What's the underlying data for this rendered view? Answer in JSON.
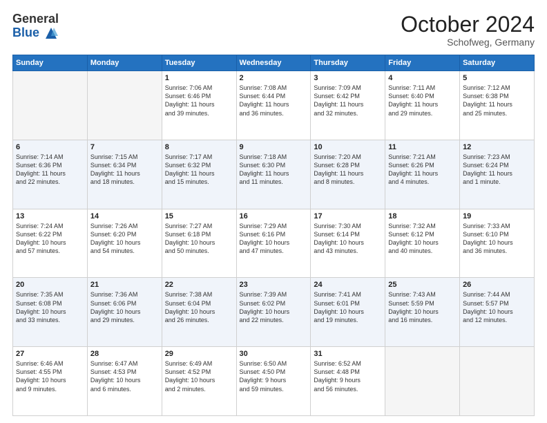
{
  "header": {
    "logo_general": "General",
    "logo_blue": "Blue",
    "month_title": "October 2024",
    "subtitle": "Schofweg, Germany"
  },
  "days_of_week": [
    "Sunday",
    "Monday",
    "Tuesday",
    "Wednesday",
    "Thursday",
    "Friday",
    "Saturday"
  ],
  "weeks": [
    [
      {
        "day": "",
        "info": ""
      },
      {
        "day": "",
        "info": ""
      },
      {
        "day": "1",
        "info": "Sunrise: 7:06 AM\nSunset: 6:46 PM\nDaylight: 11 hours\nand 39 minutes."
      },
      {
        "day": "2",
        "info": "Sunrise: 7:08 AM\nSunset: 6:44 PM\nDaylight: 11 hours\nand 36 minutes."
      },
      {
        "day": "3",
        "info": "Sunrise: 7:09 AM\nSunset: 6:42 PM\nDaylight: 11 hours\nand 32 minutes."
      },
      {
        "day": "4",
        "info": "Sunrise: 7:11 AM\nSunset: 6:40 PM\nDaylight: 11 hours\nand 29 minutes."
      },
      {
        "day": "5",
        "info": "Sunrise: 7:12 AM\nSunset: 6:38 PM\nDaylight: 11 hours\nand 25 minutes."
      }
    ],
    [
      {
        "day": "6",
        "info": "Sunrise: 7:14 AM\nSunset: 6:36 PM\nDaylight: 11 hours\nand 22 minutes."
      },
      {
        "day": "7",
        "info": "Sunrise: 7:15 AM\nSunset: 6:34 PM\nDaylight: 11 hours\nand 18 minutes."
      },
      {
        "day": "8",
        "info": "Sunrise: 7:17 AM\nSunset: 6:32 PM\nDaylight: 11 hours\nand 15 minutes."
      },
      {
        "day": "9",
        "info": "Sunrise: 7:18 AM\nSunset: 6:30 PM\nDaylight: 11 hours\nand 11 minutes."
      },
      {
        "day": "10",
        "info": "Sunrise: 7:20 AM\nSunset: 6:28 PM\nDaylight: 11 hours\nand 8 minutes."
      },
      {
        "day": "11",
        "info": "Sunrise: 7:21 AM\nSunset: 6:26 PM\nDaylight: 11 hours\nand 4 minutes."
      },
      {
        "day": "12",
        "info": "Sunrise: 7:23 AM\nSunset: 6:24 PM\nDaylight: 11 hours\nand 1 minute."
      }
    ],
    [
      {
        "day": "13",
        "info": "Sunrise: 7:24 AM\nSunset: 6:22 PM\nDaylight: 10 hours\nand 57 minutes."
      },
      {
        "day": "14",
        "info": "Sunrise: 7:26 AM\nSunset: 6:20 PM\nDaylight: 10 hours\nand 54 minutes."
      },
      {
        "day": "15",
        "info": "Sunrise: 7:27 AM\nSunset: 6:18 PM\nDaylight: 10 hours\nand 50 minutes."
      },
      {
        "day": "16",
        "info": "Sunrise: 7:29 AM\nSunset: 6:16 PM\nDaylight: 10 hours\nand 47 minutes."
      },
      {
        "day": "17",
        "info": "Sunrise: 7:30 AM\nSunset: 6:14 PM\nDaylight: 10 hours\nand 43 minutes."
      },
      {
        "day": "18",
        "info": "Sunrise: 7:32 AM\nSunset: 6:12 PM\nDaylight: 10 hours\nand 40 minutes."
      },
      {
        "day": "19",
        "info": "Sunrise: 7:33 AM\nSunset: 6:10 PM\nDaylight: 10 hours\nand 36 minutes."
      }
    ],
    [
      {
        "day": "20",
        "info": "Sunrise: 7:35 AM\nSunset: 6:08 PM\nDaylight: 10 hours\nand 33 minutes."
      },
      {
        "day": "21",
        "info": "Sunrise: 7:36 AM\nSunset: 6:06 PM\nDaylight: 10 hours\nand 29 minutes."
      },
      {
        "day": "22",
        "info": "Sunrise: 7:38 AM\nSunset: 6:04 PM\nDaylight: 10 hours\nand 26 minutes."
      },
      {
        "day": "23",
        "info": "Sunrise: 7:39 AM\nSunset: 6:02 PM\nDaylight: 10 hours\nand 22 minutes."
      },
      {
        "day": "24",
        "info": "Sunrise: 7:41 AM\nSunset: 6:01 PM\nDaylight: 10 hours\nand 19 minutes."
      },
      {
        "day": "25",
        "info": "Sunrise: 7:43 AM\nSunset: 5:59 PM\nDaylight: 10 hours\nand 16 minutes."
      },
      {
        "day": "26",
        "info": "Sunrise: 7:44 AM\nSunset: 5:57 PM\nDaylight: 10 hours\nand 12 minutes."
      }
    ],
    [
      {
        "day": "27",
        "info": "Sunrise: 6:46 AM\nSunset: 4:55 PM\nDaylight: 10 hours\nand 9 minutes."
      },
      {
        "day": "28",
        "info": "Sunrise: 6:47 AM\nSunset: 4:53 PM\nDaylight: 10 hours\nand 6 minutes."
      },
      {
        "day": "29",
        "info": "Sunrise: 6:49 AM\nSunset: 4:52 PM\nDaylight: 10 hours\nand 2 minutes."
      },
      {
        "day": "30",
        "info": "Sunrise: 6:50 AM\nSunset: 4:50 PM\nDaylight: 9 hours\nand 59 minutes."
      },
      {
        "day": "31",
        "info": "Sunrise: 6:52 AM\nSunset: 4:48 PM\nDaylight: 9 hours\nand 56 minutes."
      },
      {
        "day": "",
        "info": ""
      },
      {
        "day": "",
        "info": ""
      }
    ]
  ]
}
